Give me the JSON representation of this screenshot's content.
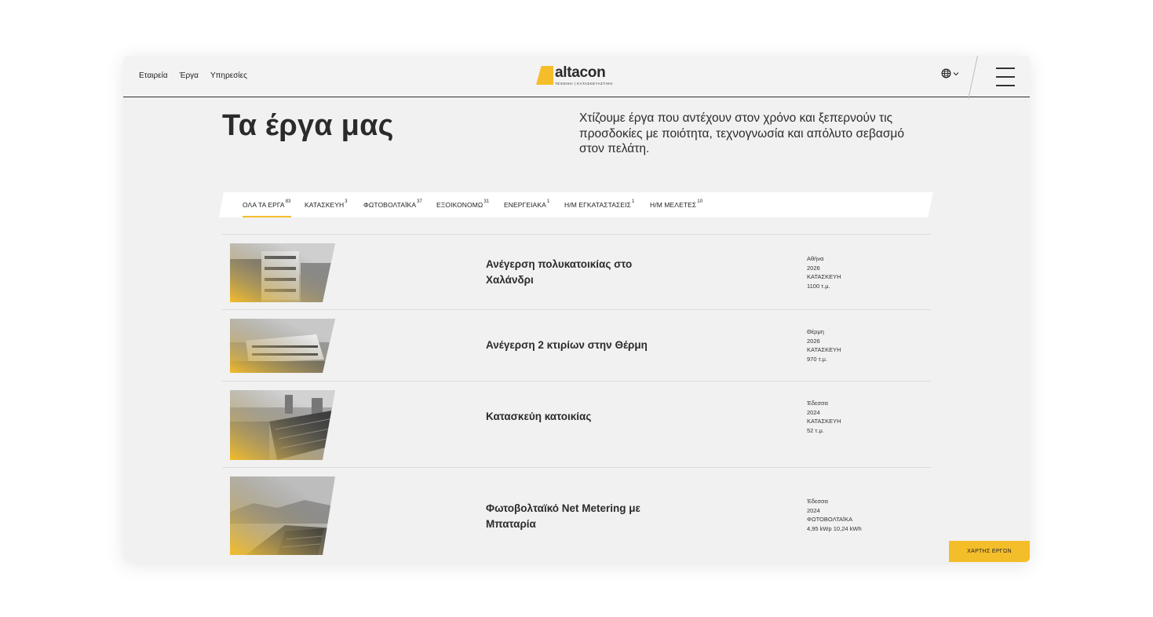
{
  "header": {
    "nav": [
      "Εταιρεία",
      "Έργα",
      "Υπηρεσίες"
    ],
    "logo": {
      "word": "altacon",
      "subtitle": "ΤΕΧΝΙΚΗ  |  ΚΑΤΑΣΚΕΥΑΣΤΙΚΗ"
    },
    "language_icon": "globe-icon",
    "menu_icon": "hamburger-icon"
  },
  "hero": {
    "title": "Τα έργα μας",
    "intro": "Χτίζουμε έργα που αντέχουν στον χρόνο και ξεπερνούν τις προσδοκίες με ποιότητα, τεχνογνωσία και απόλυτο σεβασμό στον πελάτη."
  },
  "tabs": [
    {
      "label": "ΟΛΑ ΤΑ ΕΡΓΑ",
      "count": "83",
      "active": true
    },
    {
      "label": "ΚΑΤΑΣΚΕΥΗ",
      "count": "3",
      "active": false
    },
    {
      "label": "ΦΩΤΟΒΟΛΤΑΪΚΑ",
      "count": "37",
      "active": false
    },
    {
      "label": "ΕΞΟΙΚΟΝΟΜΩ",
      "count": "31",
      "active": false
    },
    {
      "label": "ΕΝΕΡΓΕΙΑΚΑ",
      "count": "1",
      "active": false
    },
    {
      "label": "Η/Μ ΕΓΚΑΤΑΣΤΑΣΕΙΣ",
      "count": "1",
      "active": false
    },
    {
      "label": "Η/Μ ΜΕΛΕΤΕΣ",
      "count": "10",
      "active": false
    }
  ],
  "projects": [
    {
      "title": "Ανέγερση πολυκατοικίας στο Χαλάνδρι",
      "location": "Αθήνα",
      "year": "2026",
      "category": "ΚΑΤΑΣΚΕΥΗ",
      "size": "1100 τ.μ."
    },
    {
      "title": "Ανέγερση 2 κτιρίων στην Θέρμη",
      "location": "Θέρμη",
      "year": "2026",
      "category": "ΚΑΤΑΣΚΕΥΗ",
      "size": "970 τ.μ."
    },
    {
      "title": "Κατασκεύη κατοικίας",
      "location": "Έδεσσα",
      "year": "2024",
      "category": "ΚΑΤΑΣΚΕΥΗ",
      "size": "52 τ.μ."
    },
    {
      "title": "Φωτοβολταϊκό Net Metering με Μπαταρία",
      "location": "Έδεσσα",
      "year": "2024",
      "category": "ΦΩΤΟΒΟΛΤΑΪΚΑ",
      "size": "4,95 kWp 10,24 kWh"
    }
  ],
  "map_button": "ΧΑΡΤΗΣ ΕΡΓΩΝ",
  "colors": {
    "accent": "#f4bd2a",
    "background": "#f1f1f1",
    "text": "#2b2b2b"
  }
}
